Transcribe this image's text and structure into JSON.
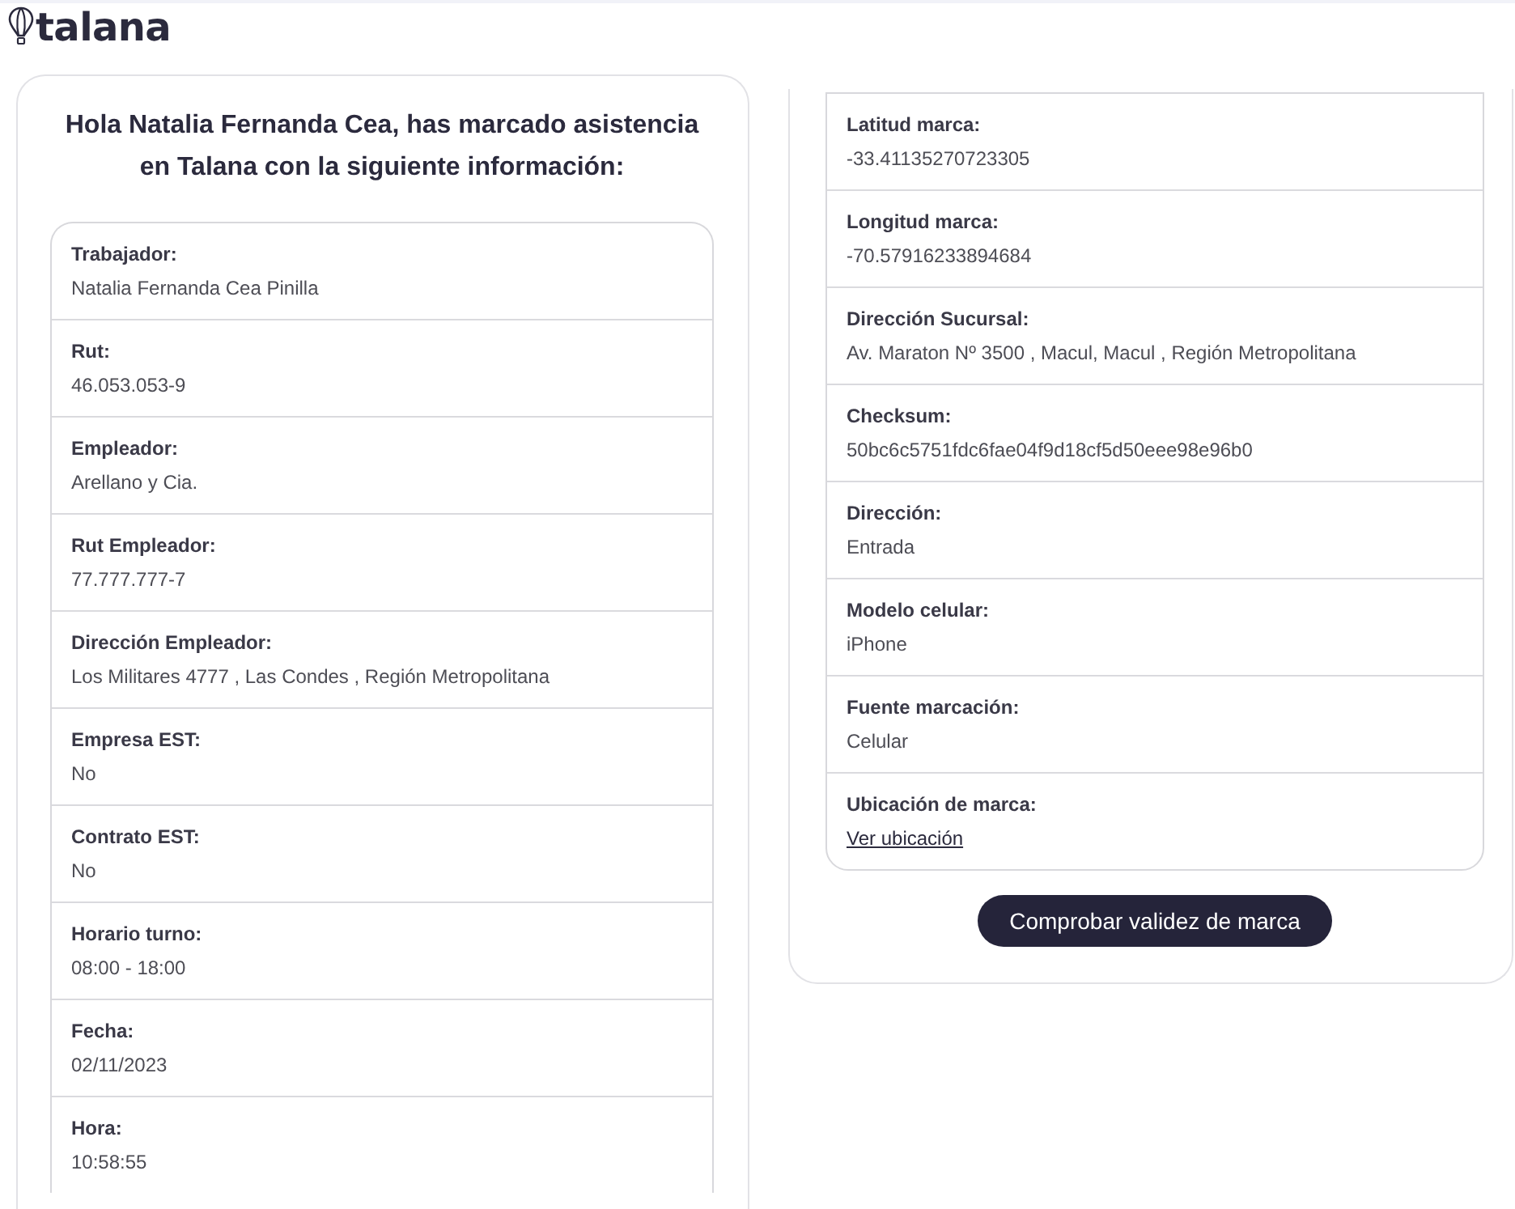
{
  "header": {
    "logo_text": "talana"
  },
  "greeting": "Hola Natalia Fernanda Cea, has marcado asistencia en Talana con la siguiente información:",
  "details_left": [
    {
      "kind": "text",
      "label": "Trabajador:",
      "value": "Natalia Fernanda Cea Pinilla"
    },
    {
      "kind": "text",
      "label": "Rut:",
      "value": "46.053.053-9"
    },
    {
      "kind": "text",
      "label": "Empleador:",
      "value": "Arellano y Cia."
    },
    {
      "kind": "text",
      "label": "Rut Empleador:",
      "value": "77.777.777-7"
    },
    {
      "kind": "text",
      "label": "Dirección Empleador:",
      "value": "Los Militares 4777 , Las Condes , Región Metropolitana"
    },
    {
      "kind": "text",
      "label": "Empresa EST:",
      "value": "No"
    },
    {
      "kind": "text",
      "label": "Contrato EST:",
      "value": "No"
    },
    {
      "kind": "text",
      "label": "Horario turno:",
      "value": "08:00 - 18:00"
    },
    {
      "kind": "text",
      "label": "Fecha:",
      "value": "02/11/2023"
    },
    {
      "kind": "text",
      "label": "Hora:",
      "value": "10:58:55"
    }
  ],
  "details_right": [
    {
      "kind": "text",
      "label": "Latitud marca:",
      "value": "-33.41135270723305"
    },
    {
      "kind": "text",
      "label": "Longitud marca:",
      "value": "-70.57916233894684"
    },
    {
      "kind": "text",
      "label": "Dirección Sucursal:",
      "value": "Av. Maraton Nº 3500 , Macul, Macul , Región Metropolitana"
    },
    {
      "kind": "text",
      "label": "Checksum:",
      "value": "50bc6c5751fdc6fae04f9d18cf5d50eee98e96b0"
    },
    {
      "kind": "text",
      "label": "Dirección:",
      "value": "Entrada"
    },
    {
      "kind": "text",
      "label": "Modelo celular:",
      "value": "iPhone"
    },
    {
      "kind": "text",
      "label": "Fuente marcación:",
      "value": "Celular"
    },
    {
      "kind": "link",
      "label": "Ubicación de marca:",
      "value": "Ver ubicación"
    }
  ],
  "verify_button": {
    "label": "Comprobar validez de marca"
  }
}
